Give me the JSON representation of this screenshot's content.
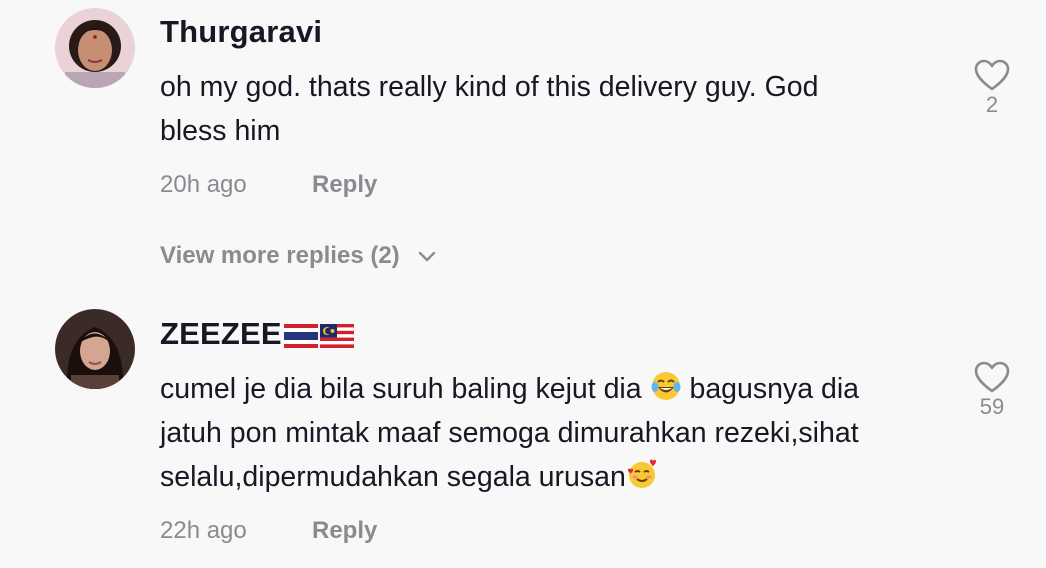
{
  "comments": [
    {
      "username": "Thurgaravi",
      "text_line1": "oh my god. thats really kind of this delivery guy. God",
      "text_line2": "bless him",
      "time": "20h ago",
      "reply_label": "Reply",
      "likes": "2",
      "view_more": "View more replies (2)"
    },
    {
      "username": "ZEEZEE",
      "text_line1a": "cumel je dia bila suruh baling kejut dia",
      "text_line1b": "bagusnya dia",
      "text_line2": "jatuh pon mintak maaf semoga dimurahkan rezeki,sihat",
      "text_line3": "selalu,dipermudahkan segala urusan",
      "time": "22h ago",
      "reply_label": "Reply",
      "likes": "59"
    }
  ],
  "icons": {
    "heart": "heart-outline-icon",
    "chevron": "chevron-down-icon",
    "flags": [
      "thailand-flag-icon",
      "malaysia-flag-icon"
    ],
    "emojis": [
      "tears-of-joy-emoji",
      "smiling-face-with-hearts-emoji"
    ]
  },
  "colors": {
    "background": "#f8f8f8",
    "primary_text": "#161823",
    "secondary_text": "#8a8b91"
  }
}
